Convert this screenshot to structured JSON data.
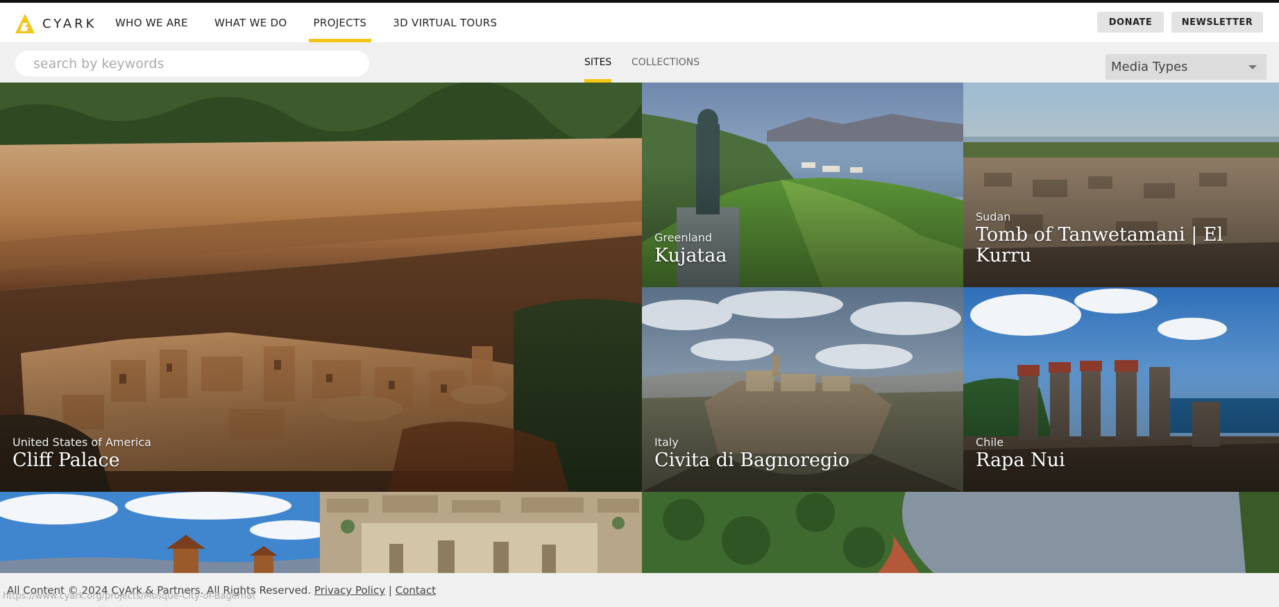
{
  "brand": {
    "name": "CYARK",
    "accent": "#f5c518"
  },
  "nav": {
    "items": [
      {
        "label": "WHO WE ARE",
        "active": false
      },
      {
        "label": "WHAT WE DO",
        "active": false
      },
      {
        "label": "PROJECTS",
        "active": true
      },
      {
        "label": "3D VIRTUAL TOURS",
        "active": false
      }
    ]
  },
  "header": {
    "donate_label": "DONATE",
    "newsletter_label": "NEWSLETTER"
  },
  "filters": {
    "search_placeholder": "search by keywords",
    "tabs": [
      {
        "label": "SITES",
        "active": true
      },
      {
        "label": "COLLECTIONS",
        "active": false
      }
    ],
    "media_types_label": "Media Types"
  },
  "sites": [
    {
      "country": "United States of America",
      "name": "Cliff Palace"
    },
    {
      "country": "Greenland",
      "name": "Kujataa"
    },
    {
      "country": "Sudan",
      "name": "Tomb of Tanwetamani | El Kurru"
    },
    {
      "country": "Italy",
      "name": "Civita di Bagnoregio"
    },
    {
      "country": "Chile",
      "name": "Rapa Nui"
    }
  ],
  "footer": {
    "copyright": "All Content © 2024 CyArk & Partners. All Rights Reserved.",
    "privacy_label": "Privacy Policy",
    "separator": "|",
    "contact_label": "Contact"
  },
  "status_url": "https://www.cyark.org/projects/Mosque-City-of-Bagerhat"
}
